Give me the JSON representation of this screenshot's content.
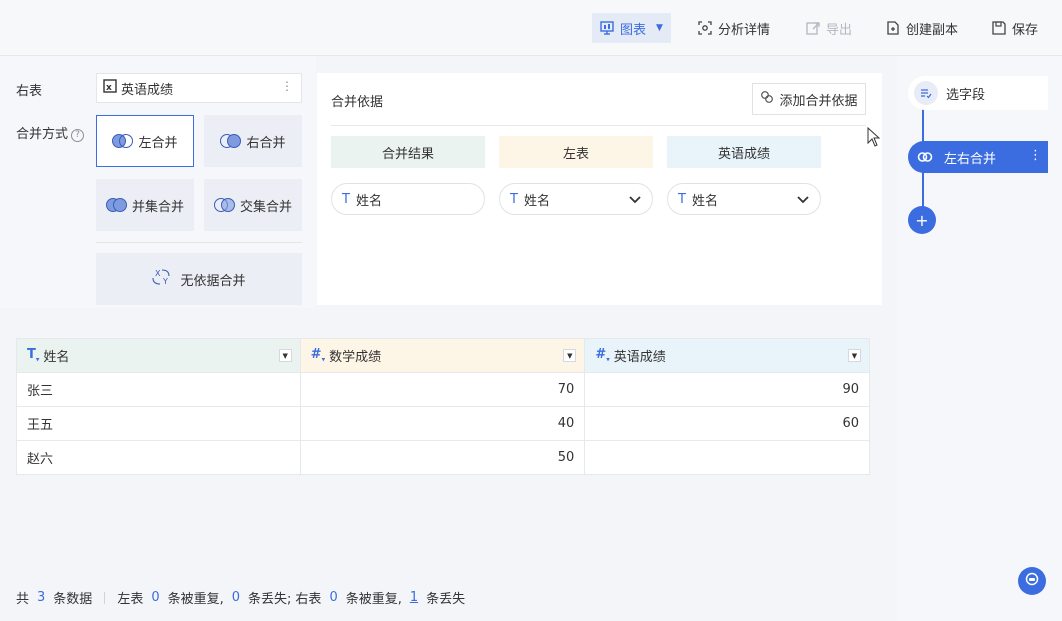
{
  "toolbar": {
    "chart": "图表",
    "analysis": "分析详情",
    "export": "导出",
    "duplicate": "创建副本",
    "save": "保存"
  },
  "config": {
    "right_table_label": "右表",
    "right_table_value": "英语成绩",
    "merge_mode_label": "合并方式",
    "merge_modes": [
      "左合并",
      "右合并",
      "并集合并",
      "交集合并"
    ],
    "selected_mode": "左合并",
    "no_basis_merge": "无依据合并"
  },
  "basis": {
    "title": "合并依据",
    "add_button": "添加合并依据",
    "columns": [
      "合并结果",
      "左表",
      "英语成绩"
    ],
    "fields": [
      "姓名",
      "姓名",
      "姓名"
    ]
  },
  "flow": {
    "step1": "选字段",
    "step2": "左右合并"
  },
  "table": {
    "headers": [
      "姓名",
      "数学成绩",
      "英语成绩"
    ],
    "rows": [
      [
        "张三",
        "70",
        "90"
      ],
      [
        "王五",
        "40",
        "60"
      ],
      [
        "赵六",
        "50",
        ""
      ]
    ]
  },
  "footer": {
    "total_prefix": "共",
    "total_count": "3",
    "total_suffix": "条数据",
    "left_label": "左表",
    "left_dup": "0",
    "dup_text": "条被重复,",
    "left_lost": "0",
    "lost_text": "条丢失;",
    "right_label": "右表",
    "right_dup": "0",
    "right_lost": "1",
    "lost_text2": "条丢失"
  },
  "colors": {
    "accent": "#3b6de0"
  }
}
